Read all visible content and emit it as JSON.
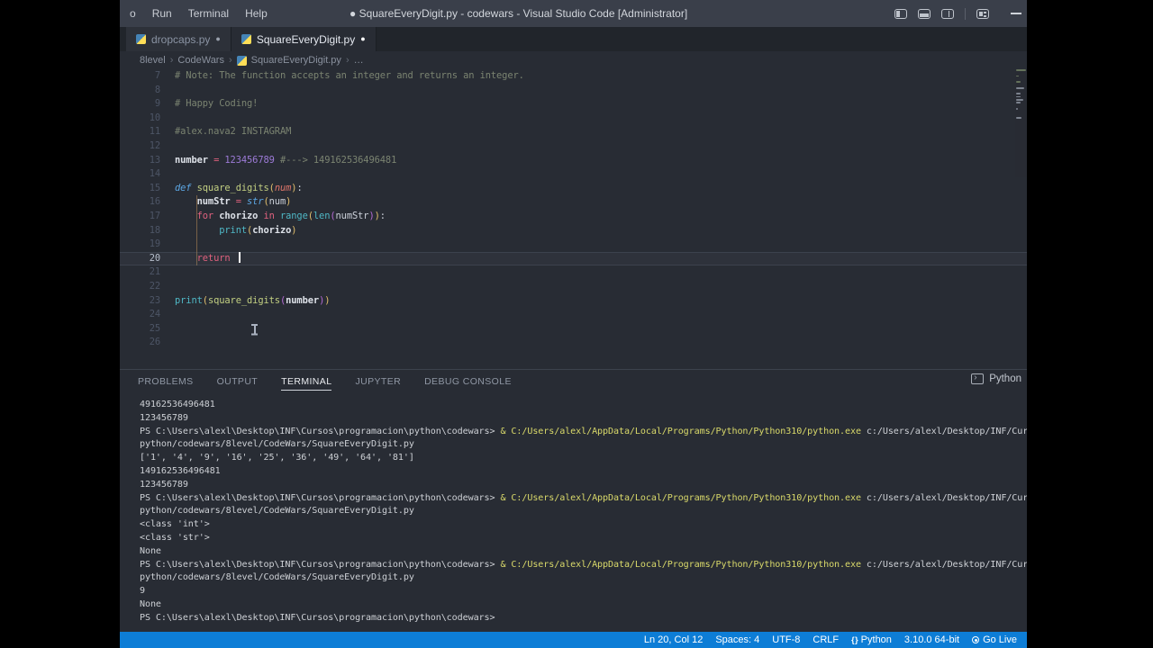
{
  "colors": {
    "status_bar_bg": "#0d7dd6",
    "terminal_command_yellow": "#d9d96a",
    "python_icon_blue": "#4584b6",
    "python_icon_yellow": "#ffde57"
  },
  "title_bar": {
    "menu_items": [
      "o",
      "Run",
      "Terminal",
      "Help"
    ],
    "title": "● SquareEveryDigit.py - codewars - Visual Studio Code [Administrator]"
  },
  "tabs": [
    {
      "label": "dropcaps.py",
      "modified_dot": "●",
      "active": false
    },
    {
      "label": "SquareEveryDigit.py",
      "modified_dot": "●",
      "active": true
    }
  ],
  "breadcrumb": {
    "items": [
      "8level",
      "CodeWars",
      "SquareEveryDigit.py",
      "…"
    ],
    "file_index": 2
  },
  "editor": {
    "cursor": {
      "line": 20,
      "col": 12
    },
    "lines": [
      {
        "num": 7,
        "seg": [
          {
            "c": "cm",
            "t": "# Note: The function accepts an integer and returns an integer."
          }
        ]
      },
      {
        "num": 8,
        "seg": []
      },
      {
        "num": 9,
        "seg": [
          {
            "c": "cm",
            "t": "# Happy Coding!"
          }
        ]
      },
      {
        "num": 10,
        "seg": []
      },
      {
        "num": 11,
        "seg": [
          {
            "c": "cm",
            "t": "#alex.nava2 INSTAGRAM"
          }
        ]
      },
      {
        "num": 12,
        "seg": []
      },
      {
        "num": 13,
        "seg": [
          {
            "c": "vr",
            "t": "number"
          },
          {
            "c": "tx",
            "t": " "
          },
          {
            "c": "kw",
            "t": "="
          },
          {
            "c": "tx",
            "t": " "
          },
          {
            "c": "nm",
            "t": "123456789"
          },
          {
            "c": "tx",
            "t": " "
          },
          {
            "c": "cm",
            "t": "#---> 149162536496481"
          }
        ]
      },
      {
        "num": 14,
        "seg": []
      },
      {
        "num": 15,
        "seg": [
          {
            "c": "kb",
            "t": "def"
          },
          {
            "c": "tx",
            "t": " "
          },
          {
            "c": "fn",
            "t": "square_digits"
          },
          {
            "c": "p1",
            "t": "("
          },
          {
            "c": "pm",
            "t": "num"
          },
          {
            "c": "p1",
            "t": ")"
          },
          {
            "c": "tx",
            "t": ":"
          }
        ]
      },
      {
        "num": 16,
        "seg": [
          {
            "c": "tx",
            "t": "    "
          },
          {
            "c": "vr",
            "t": "numStr"
          },
          {
            "c": "tx",
            "t": " "
          },
          {
            "c": "kw",
            "t": "="
          },
          {
            "c": "tx",
            "t": " "
          },
          {
            "c": "kb",
            "t": "str"
          },
          {
            "c": "p1",
            "t": "("
          },
          {
            "c": "tx",
            "t": "num"
          },
          {
            "c": "p1",
            "t": ")"
          }
        ]
      },
      {
        "num": 17,
        "seg": [
          {
            "c": "tx",
            "t": "    "
          },
          {
            "c": "kw",
            "t": "for"
          },
          {
            "c": "tx",
            "t": " "
          },
          {
            "c": "vr",
            "t": "chorizo"
          },
          {
            "c": "tx",
            "t": " "
          },
          {
            "c": "kw",
            "t": "in"
          },
          {
            "c": "tx",
            "t": " "
          },
          {
            "c": "bi",
            "t": "range"
          },
          {
            "c": "p1",
            "t": "("
          },
          {
            "c": "bi",
            "t": "len"
          },
          {
            "c": "p2",
            "t": "("
          },
          {
            "c": "tx",
            "t": "numStr"
          },
          {
            "c": "p2",
            "t": ")"
          },
          {
            "c": "p1",
            "t": ")"
          },
          {
            "c": "tx",
            "t": ":"
          }
        ]
      },
      {
        "num": 18,
        "seg": [
          {
            "c": "tx",
            "t": "        "
          },
          {
            "c": "bi",
            "t": "print"
          },
          {
            "c": "p1",
            "t": "("
          },
          {
            "c": "vr",
            "t": "chorizo"
          },
          {
            "c": "p1",
            "t": ")"
          }
        ]
      },
      {
        "num": 19,
        "seg": []
      },
      {
        "num": 20,
        "seg": [
          {
            "c": "tx",
            "t": "    "
          },
          {
            "c": "kw",
            "t": "return"
          },
          {
            "c": "tx",
            "t": " "
          }
        ]
      },
      {
        "num": 21,
        "seg": []
      },
      {
        "num": 22,
        "seg": []
      },
      {
        "num": 23,
        "seg": [
          {
            "c": "bi",
            "t": "print"
          },
          {
            "c": "p1",
            "t": "("
          },
          {
            "c": "fn",
            "t": "square_digits"
          },
          {
            "c": "p2",
            "t": "("
          },
          {
            "c": "vr",
            "t": "number"
          },
          {
            "c": "p2",
            "t": ")"
          },
          {
            "c": "p1",
            "t": ")"
          }
        ]
      },
      {
        "num": 24,
        "seg": []
      },
      {
        "num": 25,
        "seg": []
      },
      {
        "num": 26,
        "seg": []
      }
    ]
  },
  "panel": {
    "tabs": [
      {
        "label": "PROBLEMS",
        "active": false
      },
      {
        "label": "OUTPUT",
        "active": false
      },
      {
        "label": "TERMINAL",
        "active": true
      },
      {
        "label": "JUPYTER",
        "active": false
      },
      {
        "label": "DEBUG CONSOLE",
        "active": false
      }
    ],
    "shell_label": "Python"
  },
  "terminal": {
    "lines": [
      {
        "seg": [
          {
            "c": "t",
            "t": "49162536496481"
          }
        ]
      },
      {
        "seg": [
          {
            "c": "t",
            "t": "123456789"
          }
        ]
      },
      {
        "seg": [
          {
            "c": "t",
            "t": "PS C:\\Users\\alexl\\Desktop\\INF\\Cursos\\programacion\\python\\codewars> "
          },
          {
            "c": "y",
            "t": "& C:/Users/alexl/AppData/Local/Programs/Python/Python310/python.exe"
          },
          {
            "c": "t",
            "t": " c:/Users/alexl/Desktop/INF/Cursos/programacion/"
          }
        ]
      },
      {
        "seg": [
          {
            "c": "t",
            "t": "python/codewars/8level/CodeWars/SquareEveryDigit.py"
          }
        ]
      },
      {
        "seg": [
          {
            "c": "t",
            "t": "['1', '4', '9', '16', '25', '36', '49', '64', '81']"
          }
        ]
      },
      {
        "seg": [
          {
            "c": "t",
            "t": "149162536496481"
          }
        ]
      },
      {
        "seg": [
          {
            "c": "t",
            "t": "123456789"
          }
        ]
      },
      {
        "seg": [
          {
            "c": "t",
            "t": "PS C:\\Users\\alexl\\Desktop\\INF\\Cursos\\programacion\\python\\codewars> "
          },
          {
            "c": "y",
            "t": "& C:/Users/alexl/AppData/Local/Programs/Python/Python310/python.exe"
          },
          {
            "c": "t",
            "t": " c:/Users/alexl/Desktop/INF/Cursos/programacion/"
          }
        ]
      },
      {
        "seg": [
          {
            "c": "t",
            "t": "python/codewars/8level/CodeWars/SquareEveryDigit.py"
          }
        ]
      },
      {
        "seg": [
          {
            "c": "t",
            "t": "<class 'int'>"
          }
        ]
      },
      {
        "seg": [
          {
            "c": "t",
            "t": "<class 'str'>"
          }
        ]
      },
      {
        "seg": [
          {
            "c": "t",
            "t": "None"
          }
        ]
      },
      {
        "seg": [
          {
            "c": "t",
            "t": "PS C:\\Users\\alexl\\Desktop\\INF\\Cursos\\programacion\\python\\codewars> "
          },
          {
            "c": "y",
            "t": "& C:/Users/alexl/AppData/Local/Programs/Python/Python310/python.exe"
          },
          {
            "c": "t",
            "t": " c:/Users/alexl/Desktop/INF/Cursos/programacion/"
          }
        ]
      },
      {
        "seg": [
          {
            "c": "t",
            "t": "python/codewars/8level/CodeWars/SquareEveryDigit.py"
          }
        ]
      },
      {
        "seg": [
          {
            "c": "t",
            "t": "9"
          }
        ]
      },
      {
        "seg": [
          {
            "c": "t",
            "t": "None"
          }
        ]
      },
      {
        "seg": [
          {
            "c": "t",
            "t": "PS C:\\Users\\alexl\\Desktop\\INF\\Cursos\\programacion\\python\\codewars>"
          }
        ]
      }
    ]
  },
  "status_bar": {
    "right_items": [
      {
        "label": "Ln 20, Col 12",
        "icon": ""
      },
      {
        "label": "Spaces: 4",
        "icon": ""
      },
      {
        "label": "UTF-8",
        "icon": ""
      },
      {
        "label": "CRLF",
        "icon": ""
      },
      {
        "label": "Python",
        "icon": "braces"
      },
      {
        "label": "3.10.0 64-bit",
        "icon": ""
      },
      {
        "label": "Go Live",
        "icon": "broadcast"
      }
    ]
  }
}
